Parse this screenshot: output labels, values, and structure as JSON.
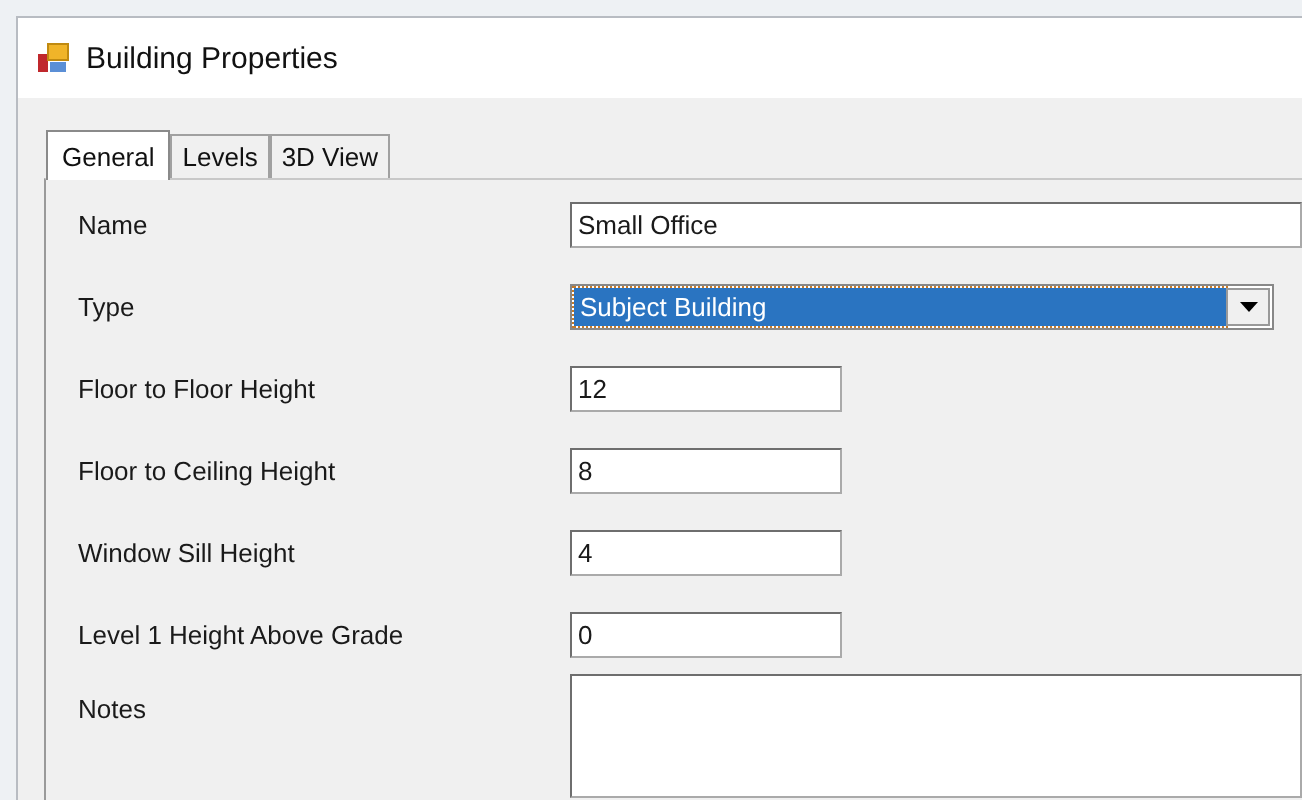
{
  "window": {
    "title": "Building Properties"
  },
  "tabs": [
    {
      "label": "General",
      "selected": true
    },
    {
      "label": "Levels",
      "selected": false
    },
    {
      "label": "3D View",
      "selected": false
    }
  ],
  "fields": [
    {
      "kind": "wide-text",
      "label": "Name",
      "value": "Small Office"
    },
    {
      "kind": "dropdown",
      "label": "Type",
      "value": "Subject Building",
      "focused": true
    },
    {
      "kind": "text",
      "label": "Floor to Floor Height",
      "value": "12"
    },
    {
      "kind": "text",
      "label": "Floor to Ceiling Height",
      "value": "8"
    },
    {
      "kind": "text",
      "label": "Window Sill Height",
      "value": "4"
    },
    {
      "kind": "text",
      "label": "Level 1 Height Above Grade",
      "value": "0"
    },
    {
      "kind": "textarea",
      "label": "Notes"
    }
  ]
}
